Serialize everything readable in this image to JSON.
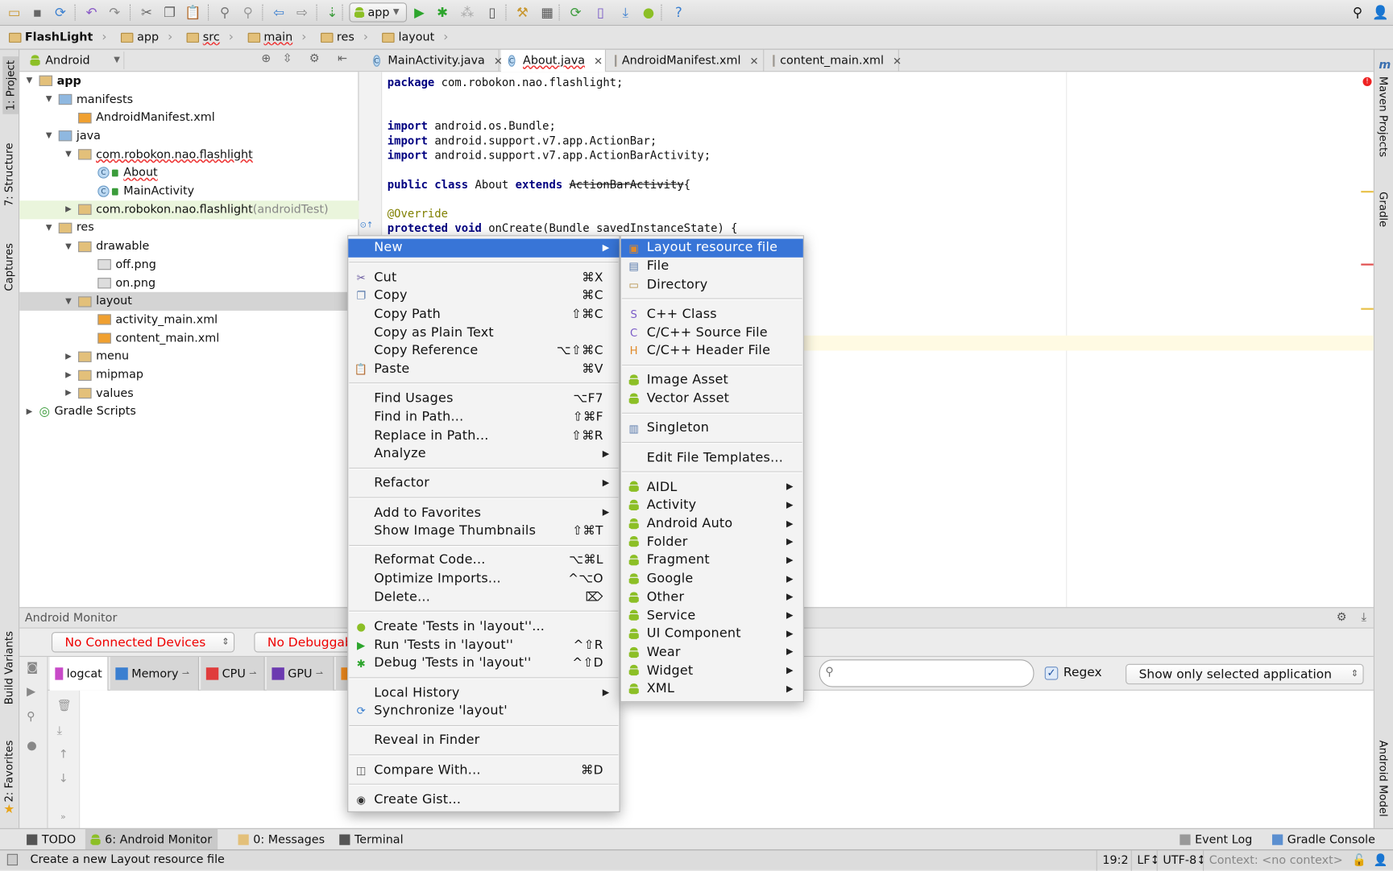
{
  "toolbar": {
    "run_config": "app",
    "icons": [
      "open-icon",
      "save-icon",
      "sync-icon",
      "undo-icon",
      "redo-icon",
      "cut-icon",
      "copy-icon",
      "paste-icon",
      "find-icon",
      "replace-icon",
      "back-icon",
      "forward-icon",
      "make-project-icon",
      "run-icon",
      "debug-icon",
      "attach-debugger-icon",
      "device-icon",
      "project-structure-icon",
      "sdk-manager-icon",
      "sync-gradle-icon",
      "avd-manager-icon",
      "sdk-download-icon",
      "android-icon",
      "help-icon"
    ]
  },
  "breadcrumb": [
    "FlashLight",
    "app",
    "src",
    "main",
    "res",
    "layout"
  ],
  "left_strip": {
    "project": "1: Project",
    "structure": "7: Structure",
    "captures": "Captures",
    "build_variants": "Build Variants",
    "favorites": "2: Favorites"
  },
  "right_strip": {
    "maven": "Maven Projects",
    "gradle": "Gradle",
    "android_model": "Android Model"
  },
  "project_panel": {
    "view": "Android",
    "tree": [
      {
        "label": "app",
        "level": 0,
        "arrow": "down",
        "icon": "app-folder",
        "bold": true
      },
      {
        "label": "manifests",
        "level": 1,
        "arrow": "down",
        "icon": "folder"
      },
      {
        "label": "AndroidManifest.xml",
        "level": 2,
        "icon": "xml"
      },
      {
        "label": "java",
        "level": 1,
        "arrow": "down",
        "icon": "folder"
      },
      {
        "label": "com.robokon.nao.flashlight",
        "level": 2,
        "arrow": "down",
        "icon": "package"
      },
      {
        "label": "About",
        "level": 3,
        "icon": "class"
      },
      {
        "label": "MainActivity",
        "level": 3,
        "icon": "class"
      },
      {
        "label": "com.robokon.nao.flashlight",
        "suffix": " (androidTest)",
        "level": 2,
        "arrow": "right",
        "icon": "package",
        "highlight": true
      },
      {
        "label": "res",
        "level": 1,
        "arrow": "down",
        "icon": "res-folder"
      },
      {
        "label": "drawable",
        "level": 2,
        "arrow": "down",
        "icon": "package"
      },
      {
        "label": "off.png",
        "level": 3,
        "icon": "image"
      },
      {
        "label": "on.png",
        "level": 3,
        "icon": "image"
      },
      {
        "label": "layout",
        "level": 2,
        "arrow": "down",
        "icon": "package",
        "selected": true
      },
      {
        "label": "activity_main.xml",
        "level": 3,
        "icon": "xml"
      },
      {
        "label": "content_main.xml",
        "level": 3,
        "icon": "xml"
      },
      {
        "label": "menu",
        "level": 2,
        "arrow": "right",
        "icon": "package"
      },
      {
        "label": "mipmap",
        "level": 2,
        "arrow": "right",
        "icon": "package"
      },
      {
        "label": "values",
        "level": 2,
        "arrow": "right",
        "icon": "package"
      },
      {
        "label": "Gradle Scripts",
        "level": 0,
        "arrow": "right",
        "icon": "gradle"
      }
    ]
  },
  "editor": {
    "tabs": [
      {
        "label": "MainActivity.java",
        "icon": "class"
      },
      {
        "label": "About.java",
        "icon": "class",
        "active": true
      },
      {
        "label": "AndroidManifest.xml",
        "icon": "xml"
      },
      {
        "label": "content_main.xml",
        "icon": "xml"
      }
    ],
    "code": [
      [
        [
          "kw",
          "package"
        ],
        [
          "",
          "com.robokon.nao.flashlight;"
        ]
      ],
      [],
      [],
      [
        [
          "kw",
          "import"
        ],
        [
          "",
          "android.os.Bundle;"
        ]
      ],
      [
        [
          "kw",
          "import"
        ],
        [
          "",
          "android.support.v7.app.ActionBar;"
        ]
      ],
      [
        [
          "kw",
          "import"
        ],
        [
          "",
          "android.support.v7.app.ActionBarActivity;"
        ]
      ],
      [],
      [
        [
          "kw",
          "public class"
        ],
        [
          "",
          "About"
        ],
        [
          "kw",
          "extends"
        ],
        [
          "strike",
          "ActionBarActivity"
        ],
        [
          "nosp",
          "{"
        ]
      ],
      [],
      [
        [
          "ann",
          "@Override"
        ]
      ],
      [
        [
          "kw",
          "protected void"
        ],
        [
          "",
          "onCreate(Bundle savedInstanceState) {"
        ]
      ]
    ]
  },
  "monitor": {
    "title": "Android Monitor",
    "device_combo": "No Connected Devices",
    "process_combo": "No Debuggable Applications",
    "tabs": [
      {
        "label": "logcat",
        "active": true
      },
      {
        "label": "Memory"
      },
      {
        "label": "CPU"
      },
      {
        "label": "GPU"
      }
    ],
    "search_value": "",
    "regex_label": "Regex",
    "regex_checked": true,
    "filter_combo": "Show only selected application"
  },
  "context_menu": [
    {
      "label": "New",
      "submenu": true,
      "selected": true
    },
    {
      "sep": true
    },
    {
      "label": "Cut",
      "shortcut": "⌘X",
      "icon": "cut-icon"
    },
    {
      "label": "Copy",
      "shortcut": "⌘C",
      "icon": "copy-icon"
    },
    {
      "label": "Copy Path",
      "shortcut": "⇧⌘C"
    },
    {
      "label": "Copy as Plain Text"
    },
    {
      "label": "Copy Reference",
      "shortcut": "⌥⇧⌘C"
    },
    {
      "label": "Paste",
      "shortcut": "⌘V",
      "icon": "paste-icon"
    },
    {
      "sep": true
    },
    {
      "label": "Find Usages",
      "shortcut": "⌥F7"
    },
    {
      "label": "Find in Path...",
      "shortcut": "⇧⌘F"
    },
    {
      "label": "Replace in Path...",
      "shortcut": "⇧⌘R"
    },
    {
      "label": "Analyze",
      "submenu": true
    },
    {
      "sep": true
    },
    {
      "label": "Refactor",
      "submenu": true
    },
    {
      "sep": true
    },
    {
      "label": "Add to Favorites",
      "submenu": true
    },
    {
      "label": "Show Image Thumbnails",
      "shortcut": "⇧⌘T"
    },
    {
      "sep": true
    },
    {
      "label": "Reformat Code...",
      "shortcut": "⌥⌘L"
    },
    {
      "label": "Optimize Imports...",
      "shortcut": "^⌥O"
    },
    {
      "label": "Delete...",
      "shortcut": "⌦"
    },
    {
      "sep": true
    },
    {
      "label": "Create 'Tests in 'layout''...",
      "icon": "android-test-icon"
    },
    {
      "label": "Run 'Tests in 'layout''",
      "shortcut": "^⇧R",
      "icon": "run-icon"
    },
    {
      "label": "Debug 'Tests in 'layout''",
      "shortcut": "^⇧D",
      "icon": "debug-icon"
    },
    {
      "sep": true
    },
    {
      "label": "Local History",
      "submenu": true
    },
    {
      "label": "Synchronize 'layout'",
      "icon": "sync-icon"
    },
    {
      "sep": true
    },
    {
      "label": "Reveal in Finder"
    },
    {
      "sep": true
    },
    {
      "label": "Compare With...",
      "shortcut": "⌘D",
      "icon": "compare-icon"
    },
    {
      "sep": true
    },
    {
      "label": "Create Gist...",
      "icon": "github-icon"
    }
  ],
  "new_submenu": [
    {
      "label": "Layout resource file",
      "icon": "layout-file-icon",
      "selected": true
    },
    {
      "label": "File",
      "icon": "file-icon"
    },
    {
      "label": "Directory",
      "icon": "folder-icon"
    },
    {
      "sep": true
    },
    {
      "label": "C++ Class",
      "icon": "cpp-class-icon"
    },
    {
      "label": "C/C++ Source File",
      "icon": "cpp-source-icon"
    },
    {
      "label": "C/C++ Header File",
      "icon": "cpp-header-icon"
    },
    {
      "sep": true
    },
    {
      "label": "Image Asset",
      "icon": "android-icon"
    },
    {
      "label": "Vector Asset",
      "icon": "android-icon"
    },
    {
      "sep": true
    },
    {
      "label": "Singleton",
      "icon": "singleton-icon"
    },
    {
      "sep": true
    },
    {
      "label": "Edit File Templates..."
    },
    {
      "sep": true
    },
    {
      "label": "AIDL",
      "icon": "android-icon",
      "submenu": true
    },
    {
      "label": "Activity",
      "icon": "android-icon",
      "submenu": true
    },
    {
      "label": "Android Auto",
      "icon": "android-icon",
      "submenu": true
    },
    {
      "label": "Folder",
      "icon": "android-icon",
      "submenu": true
    },
    {
      "label": "Fragment",
      "icon": "android-icon",
      "submenu": true
    },
    {
      "label": "Google",
      "icon": "android-icon",
      "submenu": true
    },
    {
      "label": "Other",
      "icon": "android-icon",
      "submenu": true
    },
    {
      "label": "Service",
      "icon": "android-icon",
      "submenu": true
    },
    {
      "label": "UI Component",
      "icon": "android-icon",
      "submenu": true
    },
    {
      "label": "Wear",
      "icon": "android-icon",
      "submenu": true
    },
    {
      "label": "Widget",
      "icon": "android-icon",
      "submenu": true
    },
    {
      "label": "XML",
      "icon": "android-icon",
      "submenu": true
    }
  ],
  "bottom_tools": [
    {
      "label": "TODO"
    },
    {
      "label": "6: Android Monitor",
      "active": true
    },
    {
      "label": "0: Messages"
    },
    {
      "label": "Terminal"
    }
  ],
  "bottom_right_tools": [
    "Event Log",
    "Gradle Console"
  ],
  "status": {
    "message": "Create a new Layout resource file",
    "position": "19:2",
    "line_sep": "LF↕",
    "encoding": "UTF-8↕",
    "context": "Context: <no context>"
  },
  "colors": {
    "accent": "#3875d7",
    "android_green": "#8cbf26",
    "error_red": "#ff0000",
    "keyword": "#000080",
    "annotation": "#808000"
  }
}
